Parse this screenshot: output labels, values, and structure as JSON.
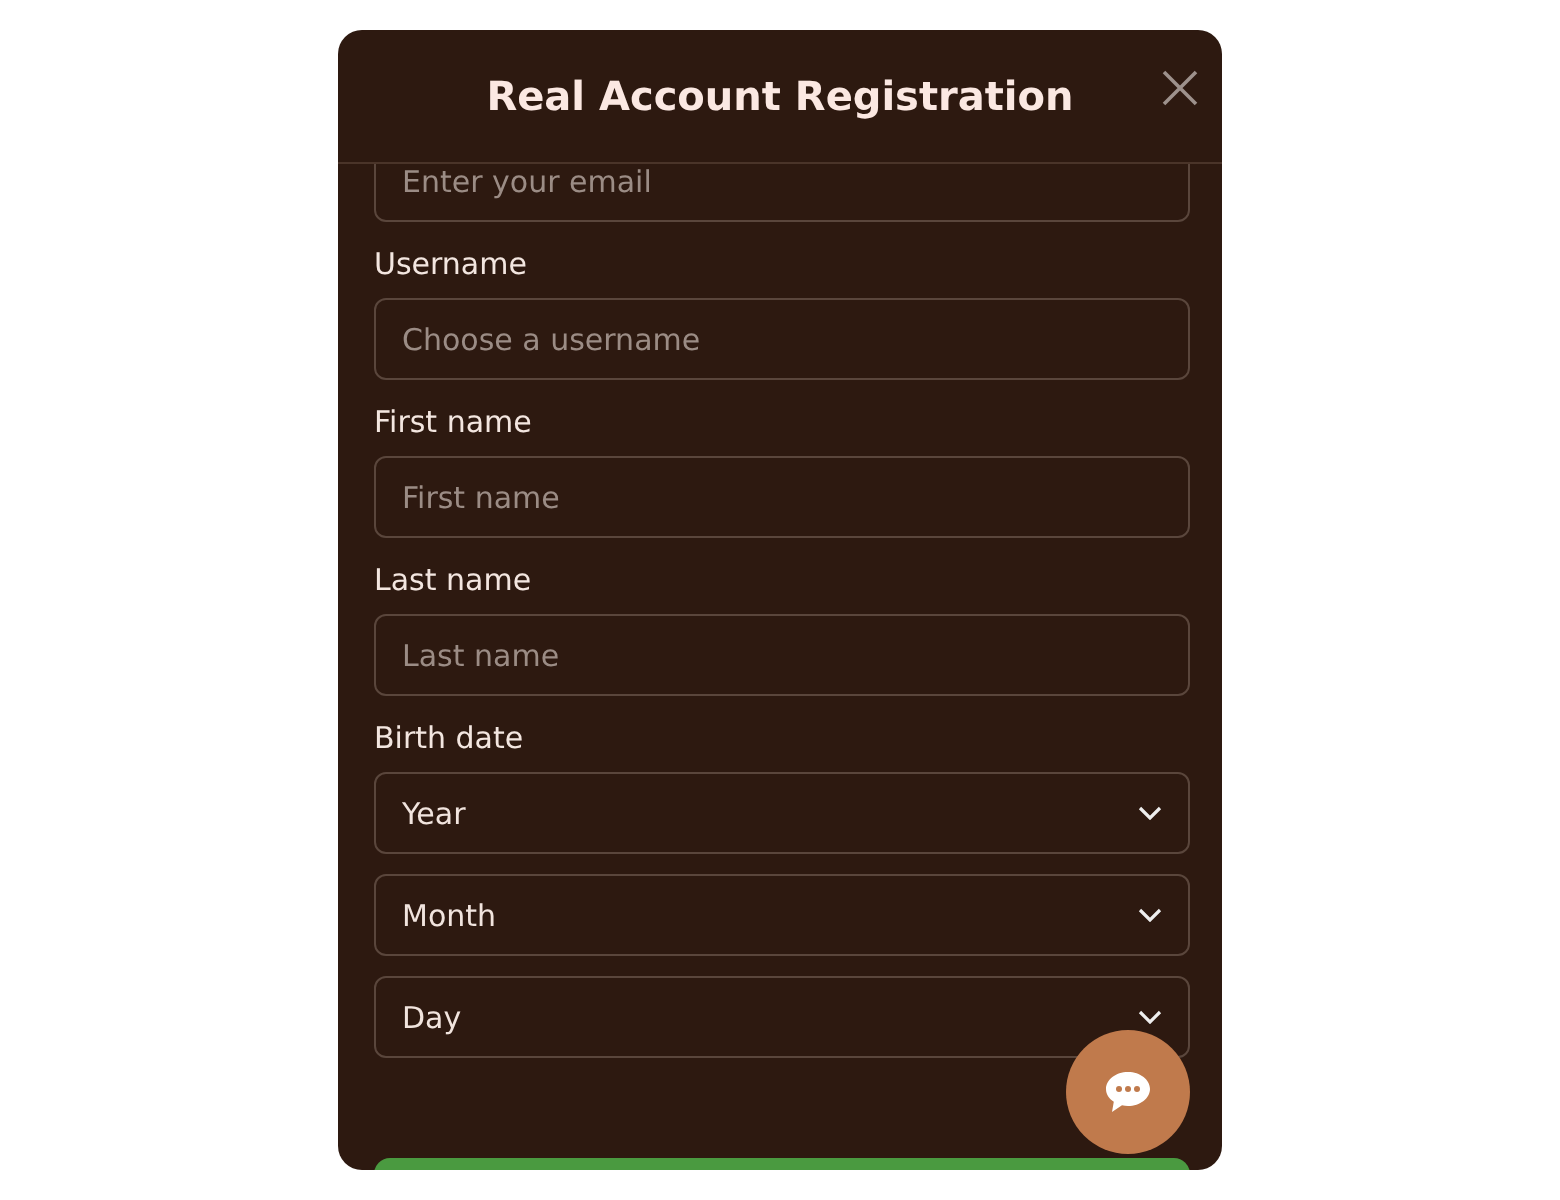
{
  "dialog": {
    "title": "Real Account Registration"
  },
  "fields": [
    {
      "kind": "input",
      "placeholder": "Enter your email"
    },
    {
      "kind": "input",
      "label": "Username",
      "placeholder": "Choose a username"
    },
    {
      "kind": "input",
      "label": "First name",
      "placeholder": "First name"
    },
    {
      "kind": "input",
      "label": "Last name",
      "placeholder": "Last name"
    },
    {
      "kind": "select",
      "label": "Birth date",
      "value": "Year"
    },
    {
      "kind": "select",
      "value": "Month"
    },
    {
      "kind": "select",
      "value": "Day"
    }
  ]
}
